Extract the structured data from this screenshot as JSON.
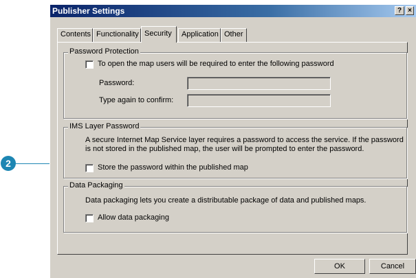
{
  "window": {
    "title": "Publisher Settings",
    "help_glyph": "?",
    "close_glyph": "×"
  },
  "tabs": [
    {
      "label": "Contents",
      "active": false
    },
    {
      "label": "Functionality",
      "active": false
    },
    {
      "label": "Security",
      "active": true
    },
    {
      "label": "Application",
      "active": false
    },
    {
      "label": "Other",
      "active": false
    }
  ],
  "password_protection": {
    "legend": "Password Protection",
    "checkbox_label": "To open the map users will be required to enter the following password",
    "checked": false,
    "password_label": "Password:",
    "password_value": "",
    "confirm_label": "Type again to confirm:",
    "confirm_value": ""
  },
  "ims_layer_password": {
    "legend": "IMS Layer Password",
    "description": "A secure Internet Map Service layer requires a password to access the service.  If the password is not stored in the published map, the user will be prompted to enter the password.",
    "checkbox_label": "Store the password within the published map",
    "checked": false
  },
  "data_packaging": {
    "legend": "Data Packaging",
    "description": "Data packaging lets you create a distributable package of data and published maps.",
    "checkbox_label": "Allow data packaging",
    "checked": false
  },
  "buttons": {
    "ok": "OK",
    "cancel": "Cancel"
  },
  "callout": {
    "number": "2"
  }
}
